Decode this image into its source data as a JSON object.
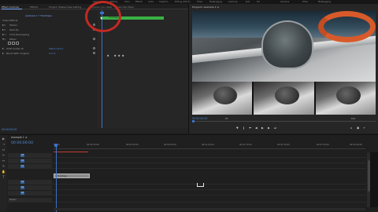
{
  "top_menu": [
    "Assembly",
    "Editing",
    "Color",
    "Effects",
    "Audio",
    "Graphics",
    "Editing (CS5.5)",
    "Titles",
    "Metalogging",
    "Learning",
    "text",
    "Tot",
    "Libraries",
    "Titles",
    "Metalogging"
  ],
  "effect_controls": {
    "tabs": [
      "Effect Controls",
      "Effects",
      "Project: Masterclass setting",
      "Source: (no clips)",
      "Audio Clip Mixer"
    ],
    "active_tab": "Effect Controls",
    "sequence_label": "example 1 * Tracktape",
    "clip_bar_label": "Tracktape",
    "rows": [
      {
        "label": "Video Effects",
        "value": ""
      },
      {
        "label": "Motion",
        "value": ""
      },
      {
        "label": "Opacity",
        "value": ""
      },
      {
        "label": "Time Remapping",
        "value": ""
      },
      {
        "label": "Effect",
        "value": ""
      },
      {
        "label": "Shift Center To",
        "value": "360.0 212.0"
      },
      {
        "label": "Blend With Original",
        "value": "0.0 %"
      }
    ],
    "timecode": "00:00:00:00"
  },
  "program_monitor": {
    "title": "Program: example 1 ≡",
    "timecode": "00:00:00:00",
    "fit": "Fit",
    "quality": "Full",
    "transport_left": [
      "▼",
      "❙",
      "⏮",
      "◀",
      "▶",
      "▶",
      "⏭"
    ],
    "transport_right": [
      "⌂",
      "▣",
      "+"
    ]
  },
  "timeline": {
    "tab": "example 1 ≡",
    "timecode": "00:00:00:00",
    "ruler_ticks": [
      "00:00",
      "00:00:15:00",
      "00:00:30:00",
      "00:00:45:00",
      "00:01:00:00",
      "00:01:15:00",
      "00:01:30:00",
      "00:01:45:00",
      "00:02:00:00"
    ],
    "tracks": [
      {
        "target": "V3",
        "name": ""
      },
      {
        "target": "V2",
        "name": ""
      },
      {
        "target": "V1",
        "name": ""
      },
      {
        "target": "A1",
        "name": ""
      },
      {
        "target": "A2",
        "name": ""
      },
      {
        "target": "A3",
        "name": ""
      },
      {
        "target": "Master",
        "name": ""
      }
    ],
    "clip_label": "Tracktape"
  },
  "colors": {
    "accent_blue": "#4f8bd6",
    "playhead": "#3b72c8",
    "highlight_red": "#c02a23",
    "clip_green": "#3bb143"
  }
}
